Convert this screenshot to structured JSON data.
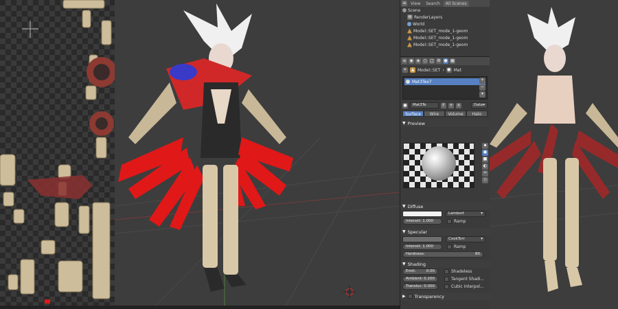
{
  "outliner": {
    "tabs": [
      "View",
      "Search",
      "All Scenes"
    ],
    "items": [
      {
        "label": "Scene",
        "kind": "scene"
      },
      {
        "label": "RenderLayers",
        "kind": "layers"
      },
      {
        "label": "World",
        "kind": "world"
      },
      {
        "label": "Model::SET_mode_1-geom",
        "kind": "object"
      },
      {
        "label": "Model::SET_mode_1-geom",
        "kind": "object"
      },
      {
        "label": "Model::SET_mode_1-geom",
        "kind": "object"
      }
    ]
  },
  "properties": {
    "breadcrumb": [
      "Model::SET",
      "Mat"
    ],
    "material_slot": "Mat3Tex7",
    "material_name": "Mat3Te",
    "data_dropdown": "Data",
    "tabs": [
      "Surface",
      "Wire",
      "Volume",
      "Halo"
    ],
    "active_tab": "Surface",
    "preview": {
      "title": "Preview"
    },
    "diffuse": {
      "title": "Diffuse",
      "shader": "Lambert",
      "intensity": "Intensit: 1.000",
      "ramp": "Ramp",
      "color": "#f2f2f2"
    },
    "specular": {
      "title": "Specular",
      "shader": "CookTorr",
      "intensity": "Intensit: 1.000",
      "ramp": "Ramp",
      "hardness_label": "Hardness:",
      "hardness_value": "80",
      "color": "#6e6e6e"
    },
    "shading": {
      "title": "Shading",
      "emit_label": "Emit:",
      "emit_value": "0.00",
      "ambient_label": "Ambient:",
      "ambient_value": "0.200",
      "translucency_label": "Transluc:",
      "translucency_value": "0.000",
      "shadeless": "Shadeless",
      "tangent": "Tangent Shadi...",
      "cubic": "Cubic Interpol..."
    },
    "transparency": {
      "title": "Transparency"
    }
  },
  "colors": {
    "accent_blue": "#5680c2",
    "armor_red": "#e01818",
    "bone": "#d8c8a8"
  }
}
